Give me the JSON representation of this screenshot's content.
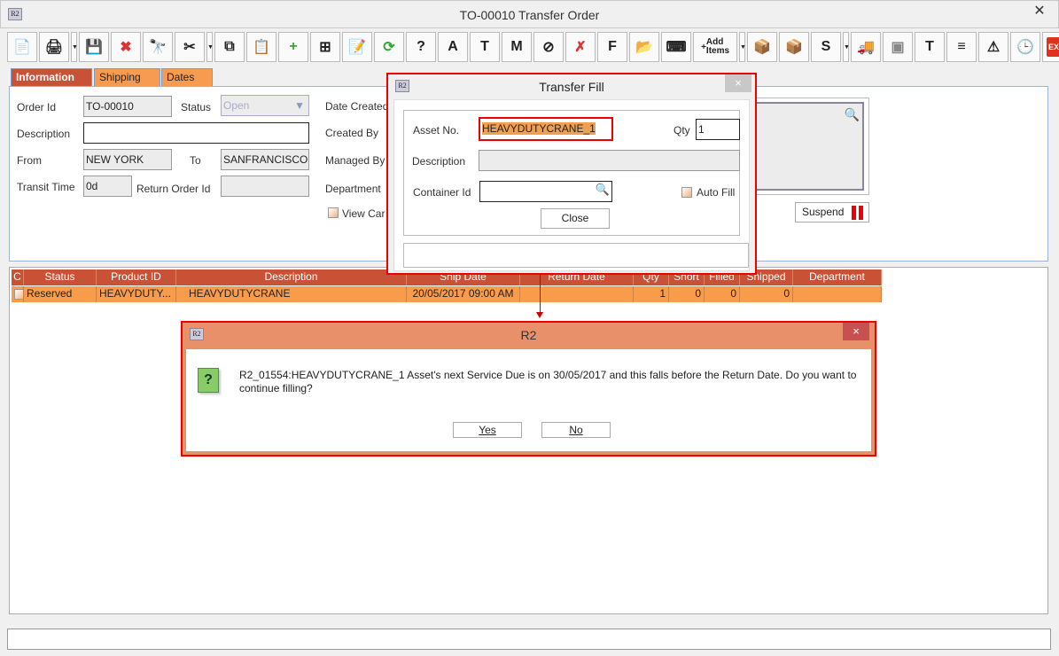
{
  "window": {
    "title": "TO-00010 Transfer Order",
    "logo": "R2"
  },
  "toolbar": {
    "icons": [
      "new-icon",
      "print-icon",
      "save-icon",
      "delete-icon",
      "find-icon",
      "cut-icon",
      "copy-icon",
      "paste-icon",
      "add-line-icon",
      "add-sub-line-icon",
      "notes-icon",
      "refresh-icon",
      "query-icon",
      "asset-icon",
      "t-card-icon",
      "misc-po-icon",
      "cancel-icon",
      "remove-doc-icon",
      "file-icon",
      "folder-clock-icon",
      "key-icon",
      "add-items-icon",
      "receive-icon",
      "receive-multi-icon",
      "ship-icon",
      "truck-icon",
      "truck-disabled-icon",
      "return-icon",
      "document-icon",
      "warning-doc-icon",
      "notes-clock-icon",
      "exit-icon"
    ],
    "add_items_label": "Add Items",
    "exit_label": "EXIT"
  },
  "tabs": [
    {
      "label": "Information",
      "active": true
    },
    {
      "label": "Shipping"
    },
    {
      "label": "Dates"
    }
  ],
  "form": {
    "order_id_label": "Order Id",
    "order_id": "TO-00010",
    "status_label": "Status",
    "status": "Open",
    "description_label": "Description",
    "description": "",
    "from_label": "From",
    "from": "NEW YORK",
    "to_label": "To",
    "to": "SANFRANCISCO",
    "transit_label": "Transit Time",
    "transit": "0d",
    "return_order_label": "Return Order Id",
    "return_order": "",
    "date_created_label": "Date Created",
    "created_by_label": "Created By",
    "managed_by_label": "Managed By",
    "department_label": "Department",
    "view_cart_label": "View Car",
    "suspend_label": "Suspend"
  },
  "table": {
    "columns": [
      "C",
      "Status",
      "Product ID",
      "Description",
      "Ship Date",
      "Return Date",
      "Qty",
      "Short",
      "Filled",
      "Shipped",
      "Department"
    ],
    "rows": [
      [
        "",
        "Reserved",
        "HEAVYDUTY...",
        "HEAVYDUTYCRANE",
        "20/05/2017 09:00 AM",
        "",
        "1",
        "0",
        "0",
        "0",
        ""
      ]
    ]
  },
  "transfer_fill": {
    "title": "Transfer Fill",
    "asset_label": "Asset No.",
    "asset": "HEAVYDUTYCRANE_1",
    "qty_label": "Qty",
    "qty": "1",
    "description_label": "Description",
    "description": "",
    "container_label": "Container Id",
    "container": "",
    "auto_fill_label": "Auto Fill",
    "close_label": "Close",
    "close_icon": "×"
  },
  "alert": {
    "title": "R2",
    "message": "R2_01554:HEAVYDUTYCRANE_1 Asset's next Service Due is on 30/05/2017 and this falls before the Return Date. Do you want to continue filling?",
    "yes_label": "Yes",
    "no_label": "No",
    "close_icon": "×",
    "icon_glyph": "?"
  },
  "colors": {
    "accent": "#c95135",
    "row": "#f89c4c",
    "highlight": "#e00000"
  }
}
